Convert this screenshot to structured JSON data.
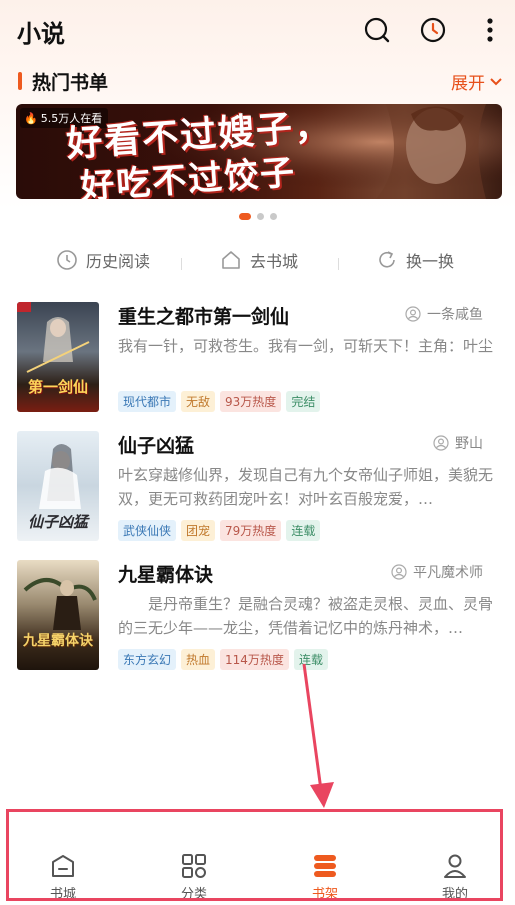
{
  "header": {
    "title": "小说",
    "icons": [
      "search-icon",
      "history-clock-icon",
      "more-vertical-icon"
    ]
  },
  "section": {
    "title": "热门书单",
    "expand_label": "展开"
  },
  "banner": {
    "heat": "5.5万人在看",
    "line1": "好看不过嫂子，",
    "line2": "好吃不过饺子"
  },
  "carousel": {
    "count": 3,
    "active": 0
  },
  "actions": [
    {
      "label": "历史阅读",
      "icon": "clock-icon"
    },
    {
      "label": "去书城",
      "icon": "home-icon"
    },
    {
      "label": "换一换",
      "icon": "refresh-icon"
    }
  ],
  "books": [
    {
      "title": "重生之都市第一剑仙",
      "author": "一条咸鱼",
      "desc": "我有一针，可救苍生。我有一剑，可斩天下！主角：叶尘",
      "cover_text": "第一剑仙",
      "tags": [
        {
          "text": "现代都市",
          "style": "blue"
        },
        {
          "text": "无敌",
          "style": "yellow"
        },
        {
          "text": "93万热度",
          "style": "red"
        },
        {
          "text": "完结",
          "style": "green"
        }
      ]
    },
    {
      "title": "仙子凶猛",
      "author": "野山",
      "desc": "叶玄穿越修仙界，发现自己有九个女帝仙子师姐，美貌无双，更无可救药团宠叶玄！对叶玄百般宠爱，…",
      "cover_text": "仙子凶猛",
      "tags": [
        {
          "text": "武侠仙侠",
          "style": "blue"
        },
        {
          "text": "团宠",
          "style": "yellow"
        },
        {
          "text": "79万热度",
          "style": "red"
        },
        {
          "text": "连载",
          "style": "green"
        }
      ]
    },
    {
      "title": "九星霸体诀",
      "author": "平凡魔术师",
      "desc": "　　是丹帝重生？是融合灵魂？被盗走灵根、灵血、灵骨的三无少年——龙尘，凭借着记忆中的炼丹神术，…",
      "cover_text": "九星霸体诀",
      "tags": [
        {
          "text": "东方玄幻",
          "style": "blue"
        },
        {
          "text": "热血",
          "style": "yellow"
        },
        {
          "text": "114万热度",
          "style": "red"
        },
        {
          "text": "连载",
          "style": "green"
        }
      ]
    }
  ],
  "tabbar": {
    "items": [
      {
        "label": "书城",
        "icon": "bookstore-icon"
      },
      {
        "label": "分类",
        "icon": "category-icon"
      },
      {
        "label": "书架",
        "icon": "bookshelf-icon",
        "active": true
      },
      {
        "label": "我的",
        "icon": "profile-icon"
      }
    ]
  },
  "colors": {
    "accent": "#ee5a1f",
    "annotation": "#e94560"
  }
}
